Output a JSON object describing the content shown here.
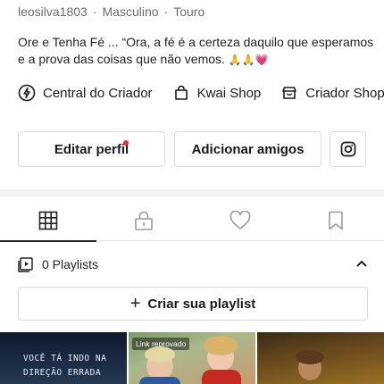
{
  "profile": {
    "username": "leosilva1803",
    "gender": "Masculino",
    "sign": "Touro",
    "separator": "·",
    "bio_text": "Ore e Tenha Fé ... “Ora, a fé é a certeza daquilo que esperamos e a prova das coisas que não vemos.",
    "bio_emojis": "🙏🙏💗"
  },
  "links": {
    "creator_center": "Central do Criador",
    "kwai_shop": "Kwai Shop",
    "creator_shop": "Criador Shop"
  },
  "buttons": {
    "edit_profile": "Editar perfil",
    "add_friends": "Adicionar amigos",
    "instagram_icon": "instagram-icon"
  },
  "tabs": [
    {
      "icon": "grid-icon",
      "active": true
    },
    {
      "icon": "lock-icon",
      "active": false
    },
    {
      "icon": "heart-icon",
      "active": false
    },
    {
      "icon": "bookmark-icon",
      "active": false
    }
  ],
  "playlists": {
    "count_label": "0 Playlists",
    "create_label": "Criar sua playlist",
    "plus": "+"
  },
  "thumbnails": [
    {
      "text_line1": "Você tá indo na",
      "text_line2": "direção errada"
    },
    {
      "badge": "Link reprovado"
    },
    {}
  ],
  "colors": {
    "notification_dot": "#ff2b2b",
    "text": "#222222",
    "muted": "#6b6b6b"
  }
}
